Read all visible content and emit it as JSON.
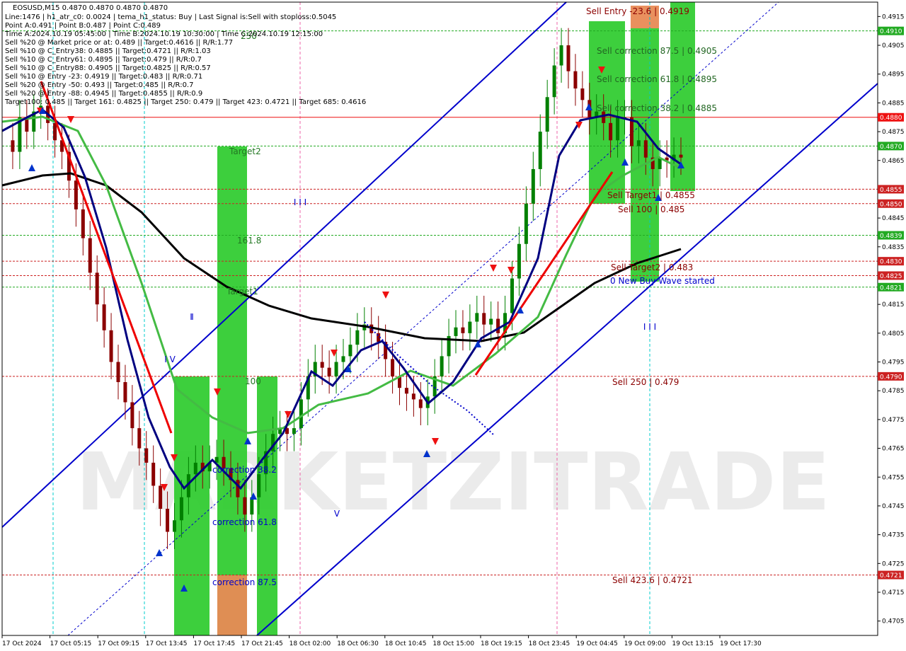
{
  "header": {
    "symbol_line": "EOSUSD,M15  0.4870 0.4870 0.4870 0.4870",
    "lines": [
      "Line:1476 | h1_atr_c0: 0.0024 | tema_h1_status: Buy | Last Signal is:Sell with stoploss:0.5045",
      "Point A:0.491 | Point B:0.487 | Point C:0.489",
      "Time A:2024.10.19 05:45:00 | Time B:2024.10.19 10:30:00 | Time C:2024.10.19 12:15:00",
      "Sell %20 @ Market price or at: 0.489 || Target:0.4616 || R/R:1.77",
      "Sell %10 @ C_Entry38: 0.4885 || Target:0.4721 || R/R:1.03",
      "Sell %10 @ C_Entry61: 0.4895 || Target:0.479 || R/R:0.7",
      "Sell %10 @ C_Entry88: 0.4905 || Target:0.4825 || R/R:0.57",
      "Sell %10 @ Entry -23: 0.4919 || Target:0.483 || R/R:0.71",
      "Sell %20 @ Entry -50: 0.493 || Target:0.485 || R/R:0.7",
      "Sell %20 @ Entry -88: 0.4945 || Target:0.4855 || R/R:0.9",
      "Target100: 0.485 || Target 161: 0.4825 || Target 250: 0.479 || Target 423: 0.4721 || Target 685: 0.4616"
    ]
  },
  "watermark": "MARKETZITRADE",
  "colors": {
    "up_candle": "#008000",
    "down_candle": "#8b0000",
    "channel": "#0000cc",
    "green_zone": "#33cc33",
    "orange_zone": "#e88a55",
    "sell_level": "#8b0000",
    "buy_level": "#006400",
    "ma_black": "#000000",
    "ma_navy": "#000080",
    "ma_green": "#44bb44",
    "red_line": "#ee0000"
  },
  "chart_data": {
    "type": "candlestick",
    "symbol": "EOSUSD",
    "timeframe": "M15",
    "ylim": [
      0.47,
      0.492
    ],
    "price_ticks": [
      "0.4915",
      "0.4905",
      "0.4895",
      "0.4885",
      "0.4875",
      "0.4865",
      "0.4855",
      "0.4845",
      "0.4835",
      "0.4825",
      "0.4815",
      "0.4805",
      "0.4795",
      "0.4785",
      "0.4775",
      "0.4765",
      "0.4755",
      "0.4745",
      "0.4735",
      "0.4725",
      "0.4715",
      "0.4705"
    ],
    "time_labels": [
      "17 Oct 2024",
      "17 Oct 05:15",
      "17 Oct 09:15",
      "17 Oct 13:45",
      "17 Oct 17:45",
      "17 Oct 21:45",
      "18 Oct 02:00",
      "18 Oct 06:30",
      "18 Oct 10:45",
      "18 Oct 15:00",
      "18 Oct 19:15",
      "18 Oct 23:45",
      "19 Oct 04:45",
      "19 Oct 09:00",
      "19 Oct 13:15",
      "19 Oct 17:30"
    ],
    "close_series": [
      0.4872,
      0.4868,
      0.488,
      0.4875,
      0.4882,
      0.4884,
      0.4878,
      0.4872,
      0.4868,
      0.4858,
      0.4848,
      0.4838,
      0.4826,
      0.4815,
      0.4806,
      0.4795,
      0.4788,
      0.4781,
      0.4772,
      0.4765,
      0.476,
      0.4752,
      0.4744,
      0.4736,
      0.474,
      0.4748,
      0.4756,
      0.476,
      0.4757,
      0.476,
      0.4762,
      0.4758,
      0.4754,
      0.4748,
      0.4742,
      0.4748,
      0.4756,
      0.4764,
      0.477,
      0.4772,
      0.477,
      0.4772,
      0.4782,
      0.479,
      0.4795,
      0.4793,
      0.479,
      0.4795,
      0.4797,
      0.4801,
      0.4806,
      0.4808,
      0.4805,
      0.4802,
      0.4796,
      0.479,
      0.4786,
      0.4784,
      0.4782,
      0.4779,
      0.4783,
      0.479,
      0.4797,
      0.4804,
      0.4807,
      0.4805,
      0.4809,
      0.4812,
      0.4808,
      0.481,
      0.4805,
      0.4812,
      0.4824,
      0.4836,
      0.485,
      0.4862,
      0.4875,
      0.4887,
      0.4898,
      0.4905,
      0.4896,
      0.489,
      0.4886,
      0.488,
      0.4882,
      0.4878,
      0.4872,
      0.488,
      0.488,
      0.487,
      0.4872,
      0.4866,
      0.4862,
      0.4866,
      0.4865,
      0.4867,
      0.4866
    ],
    "levels": [
      {
        "label": "Sell Entry -23.6 | 0.4919",
        "price": 0.4919,
        "kind": "sell"
      },
      {
        "label": "Sell correction 87.5 | 0.4905",
        "price": 0.4905,
        "kind": "sell"
      },
      {
        "label": "Sell correction 61.8 | 0.4895",
        "price": 0.4895,
        "kind": "sell"
      },
      {
        "label": "Sell correction 38.2 | 0.4885",
        "price": 0.4885,
        "kind": "sell"
      },
      {
        "label": "Sell Target1 | 0.4855",
        "price": 0.4855,
        "kind": "sell"
      },
      {
        "label": "Sell 100 | 0.485",
        "price": 0.485,
        "kind": "sell"
      },
      {
        "label": "Sell Target2 | 0.483",
        "price": 0.483,
        "kind": "sell"
      },
      {
        "label": "Sell 250 | 0.479",
        "price": 0.479,
        "kind": "sell"
      },
      {
        "label": "Sell 423.6 | 0.4721",
        "price": 0.4721,
        "kind": "sell"
      }
    ],
    "price_badges": [
      {
        "price": 0.491,
        "text": "0.4910",
        "bg": "#22aa22"
      },
      {
        "price": 0.488,
        "text": "0.4880",
        "bg": "#ee1111"
      },
      {
        "price": 0.487,
        "text": "0.4870",
        "bg": "#22aa22"
      },
      {
        "price": 0.4855,
        "text": "0.4855",
        "bg": "#cc2222"
      },
      {
        "price": 0.485,
        "text": "0.4850",
        "bg": "#cc2222"
      },
      {
        "price": 0.4839,
        "text": "0.4839",
        "bg": "#22aa22"
      },
      {
        "price": 0.483,
        "text": "0.4830",
        "bg": "#cc2222"
      },
      {
        "price": 0.4825,
        "text": "0.4825",
        "bg": "#cc2222"
      },
      {
        "price": 0.4821,
        "text": "0.4821",
        "bg": "#22aa22"
      },
      {
        "price": 0.479,
        "text": "0.4790",
        "bg": "#cc2222"
      },
      {
        "price": 0.4721,
        "text": "0.4721",
        "bg": "#cc2222"
      }
    ],
    "zone_labels": [
      {
        "text": "Target2",
        "color": "#227722"
      },
      {
        "text": "161.8",
        "color": "#227722"
      },
      {
        "text": "Target1",
        "color": "#227722"
      },
      {
        "text": "100",
        "color": "#227722"
      },
      {
        "text": "correction 38.2",
        "color": "#0000cc"
      },
      {
        "text": "correction 61.8",
        "color": "#0000cc"
      },
      {
        "text": "correction 87.5",
        "color": "#0000cc"
      },
      {
        "text": "0 New Buy Wave started",
        "color": "#0000cc"
      },
      {
        "text": "250",
        "color": "#227722"
      }
    ],
    "wave_labels": [
      "I I I",
      "I",
      "I V",
      "V",
      "I I I",
      "I"
    ]
  }
}
